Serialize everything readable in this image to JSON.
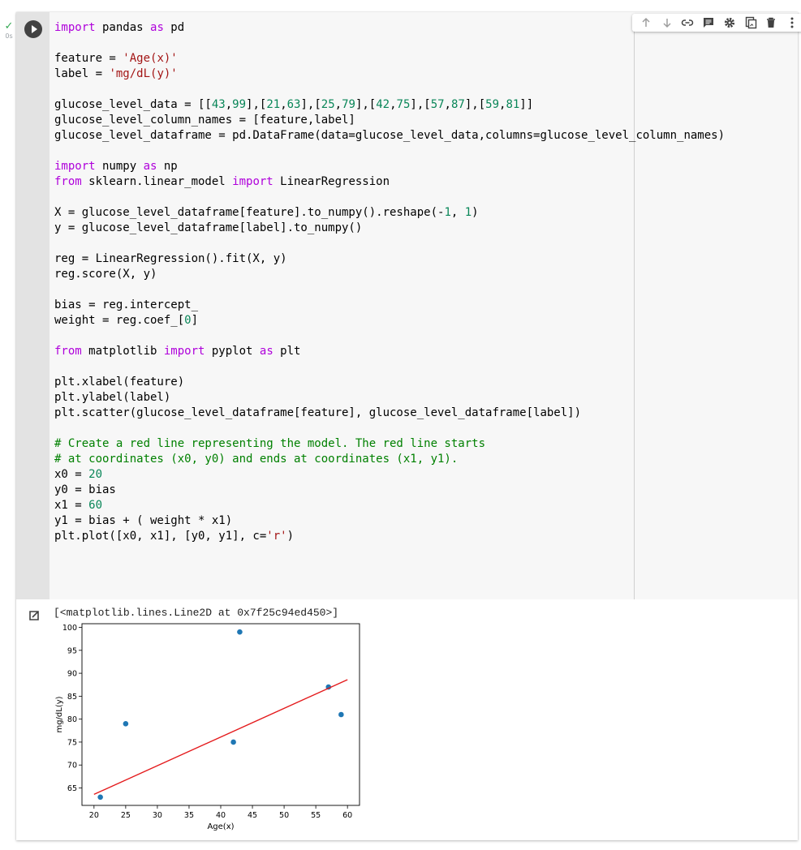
{
  "status": {
    "check": "✓",
    "exec_time": "0s"
  },
  "toolbar": {
    "buttons": [
      {
        "name": "move-cell-up-button",
        "icon": "arrow-up-icon"
      },
      {
        "name": "move-cell-down-button",
        "icon": "arrow-down-icon"
      },
      {
        "name": "link-to-cell-button",
        "icon": "link-icon"
      },
      {
        "name": "add-comment-button",
        "icon": "comment-icon"
      },
      {
        "name": "editor-settings-button",
        "icon": "gear-icon"
      },
      {
        "name": "mirror-cell-button",
        "icon": "mirror-cell-icon"
      },
      {
        "name": "delete-cell-button",
        "icon": "trash-icon"
      },
      {
        "name": "more-actions-button",
        "icon": "more-vert-icon"
      }
    ]
  },
  "code_lines": [
    [
      [
        "kw",
        "import"
      ],
      [
        "t",
        " pandas "
      ],
      [
        "kw",
        "as"
      ],
      [
        "t",
        " pd"
      ]
    ],
    [],
    [
      [
        "t",
        "feature = "
      ],
      [
        "str",
        "'Age(x)'"
      ]
    ],
    [
      [
        "t",
        "label = "
      ],
      [
        "str",
        "'mg/dL(y)'"
      ]
    ],
    [],
    [
      [
        "t",
        "glucose_level_data = [["
      ],
      [
        "num",
        "43"
      ],
      [
        "t",
        ","
      ],
      [
        "num",
        "99"
      ],
      [
        "t",
        "],["
      ],
      [
        "num",
        "21"
      ],
      [
        "t",
        ","
      ],
      [
        "num",
        "63"
      ],
      [
        "t",
        "],["
      ],
      [
        "num",
        "25"
      ],
      [
        "t",
        ","
      ],
      [
        "num",
        "79"
      ],
      [
        "t",
        "],["
      ],
      [
        "num",
        "42"
      ],
      [
        "t",
        ","
      ],
      [
        "num",
        "75"
      ],
      [
        "t",
        "],["
      ],
      [
        "num",
        "57"
      ],
      [
        "t",
        ","
      ],
      [
        "num",
        "87"
      ],
      [
        "t",
        "],["
      ],
      [
        "num",
        "59"
      ],
      [
        "t",
        ","
      ],
      [
        "num",
        "81"
      ],
      [
        "t",
        "]]"
      ]
    ],
    [
      [
        "t",
        "glucose_level_column_names = [feature,label]"
      ]
    ],
    [
      [
        "t",
        "glucose_level_dataframe = pd.DataFrame(data=glucose_level_data,columns=glucose_level_column_names)"
      ]
    ],
    [],
    [
      [
        "kw",
        "import"
      ],
      [
        "t",
        " numpy "
      ],
      [
        "kw",
        "as"
      ],
      [
        "t",
        " np"
      ]
    ],
    [
      [
        "kw",
        "from"
      ],
      [
        "t",
        " sklearn.linear_model "
      ],
      [
        "kw",
        "import"
      ],
      [
        "t",
        " LinearRegression"
      ]
    ],
    [],
    [
      [
        "t",
        "X = glucose_level_dataframe[feature].to_numpy().reshape(-"
      ],
      [
        "num",
        "1"
      ],
      [
        "t",
        ", "
      ],
      [
        "num",
        "1"
      ],
      [
        "t",
        ")"
      ]
    ],
    [
      [
        "t",
        "y = glucose_level_dataframe[label].to_numpy()"
      ]
    ],
    [],
    [
      [
        "t",
        "reg = LinearRegression().fit(X, y)"
      ]
    ],
    [
      [
        "t",
        "reg.score(X, y)"
      ]
    ],
    [],
    [
      [
        "t",
        "bias = reg.intercept_"
      ]
    ],
    [
      [
        "t",
        "weight = reg.coef_["
      ],
      [
        "num",
        "0"
      ],
      [
        "t",
        "]"
      ]
    ],
    [],
    [
      [
        "kw",
        "from"
      ],
      [
        "t",
        " matplotlib "
      ],
      [
        "kw",
        "import"
      ],
      [
        "t",
        " pyplot "
      ],
      [
        "kw",
        "as"
      ],
      [
        "t",
        " plt"
      ]
    ],
    [],
    [
      [
        "t",
        "plt.xlabel(feature)"
      ]
    ],
    [
      [
        "t",
        "plt.ylabel(label)"
      ]
    ],
    [
      [
        "t",
        "plt.scatter(glucose_level_dataframe[feature], glucose_level_dataframe[label])"
      ]
    ],
    [],
    [
      [
        "cmt",
        "# Create a red line representing the model. The red line starts"
      ]
    ],
    [
      [
        "cmt",
        "# at coordinates (x0, y0) and ends at coordinates (x1, y1)."
      ]
    ],
    [
      [
        "t",
        "x0 = "
      ],
      [
        "num",
        "20"
      ]
    ],
    [
      [
        "t",
        "y0 = bias"
      ]
    ],
    [
      [
        "t",
        "x1 = "
      ],
      [
        "num",
        "60"
      ]
    ],
    [
      [
        "t",
        "y1 = bias + ( weight * x1)"
      ]
    ],
    [
      [
        "t",
        "plt.plot([x0, x1], [y0, y1], c="
      ],
      [
        "str",
        "'r'"
      ],
      [
        "t",
        ")"
      ]
    ]
  ],
  "output": {
    "text": "[<matplotlib.lines.Line2D at 0x7f25c94ed450>]"
  },
  "chart_data": {
    "type": "scatter",
    "x": [
      43,
      21,
      25,
      42,
      57,
      59
    ],
    "y": [
      99,
      63,
      79,
      75,
      87,
      81
    ],
    "xlabel": "Age(x)",
    "ylabel": "mg/dL(y)",
    "xlim": [
      18.1,
      61.9
    ],
    "ylim": [
      61.2,
      100.8
    ],
    "xticks": [
      20,
      25,
      30,
      35,
      40,
      45,
      50,
      55,
      60
    ],
    "yticks": [
      65,
      70,
      75,
      80,
      85,
      90,
      95,
      100
    ],
    "point_color": "#1f77b4",
    "line": {
      "x": [
        20,
        60
      ],
      "y": [
        63.6,
        88.6
      ],
      "color": "#e41a1c"
    },
    "grid": false
  }
}
